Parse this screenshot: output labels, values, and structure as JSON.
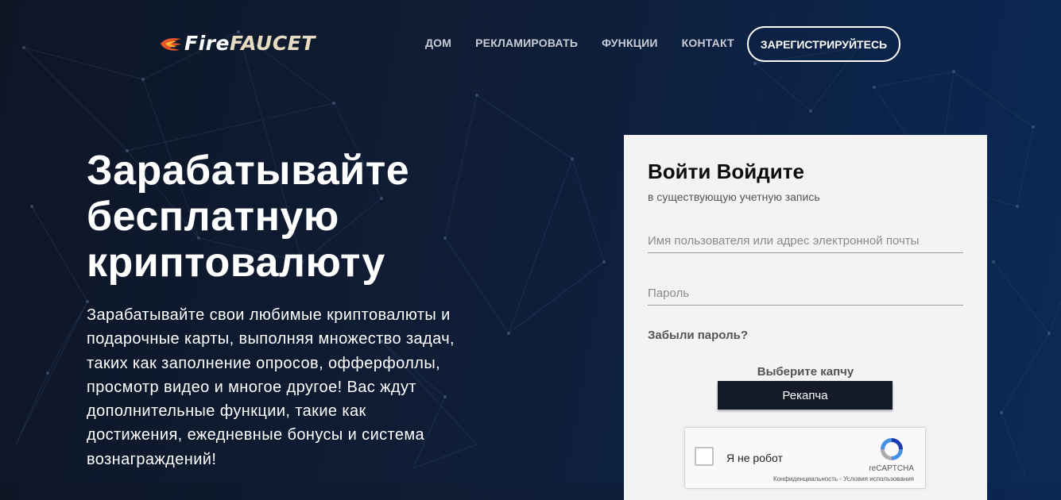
{
  "brand": {
    "fire": "Fire",
    "faucet": "FAUCET"
  },
  "nav": [
    {
      "label": "ДОМ"
    },
    {
      "label": "РЕКЛАМИРОВАТЬ"
    },
    {
      "label": "ФУНКЦИИ"
    },
    {
      "label": "КОНТАКТ"
    }
  ],
  "register_button": "ЗАРЕГИСТРИРУЙТЕСЬ",
  "hero": {
    "title_lines": [
      "Зарабатывайте",
      "бесплатную",
      "криптовалюту"
    ],
    "text": "Зарабатывайте свои любимые криптовалюты и подарочные карты, выполняя множество задач, таких как заполнение опросов, офферфоллы, просмотр видео и многое другое! Вас ждут дополнительные функции, такие как достижения, ежедневные бонусы и система вознаграждений!"
  },
  "login": {
    "title": "Войти Войдите",
    "subtitle": "в существующую учетную запись",
    "username_placeholder": "Имя пользователя или адрес электронной почты",
    "password_placeholder": "Пароль",
    "forgot_link": "Забыли пароль?",
    "captcha_label": "Выберите капчу",
    "captcha_selected": "Рекапча",
    "recaptcha": {
      "checkbox_label": "Я не робот",
      "brand": "reCAPTCHA",
      "terms": "Конфиденциальность - Условия использования"
    }
  },
  "colors": {
    "background": "#0f1d36",
    "card": "#f3f3f3",
    "captcha_button": "#141a27",
    "logo_faucet": "#e8dcc0"
  },
  "icons": {
    "logo": "flame-icon",
    "recaptcha": "recaptcha-logo-icon",
    "checkbox": "checkbox-icon"
  }
}
